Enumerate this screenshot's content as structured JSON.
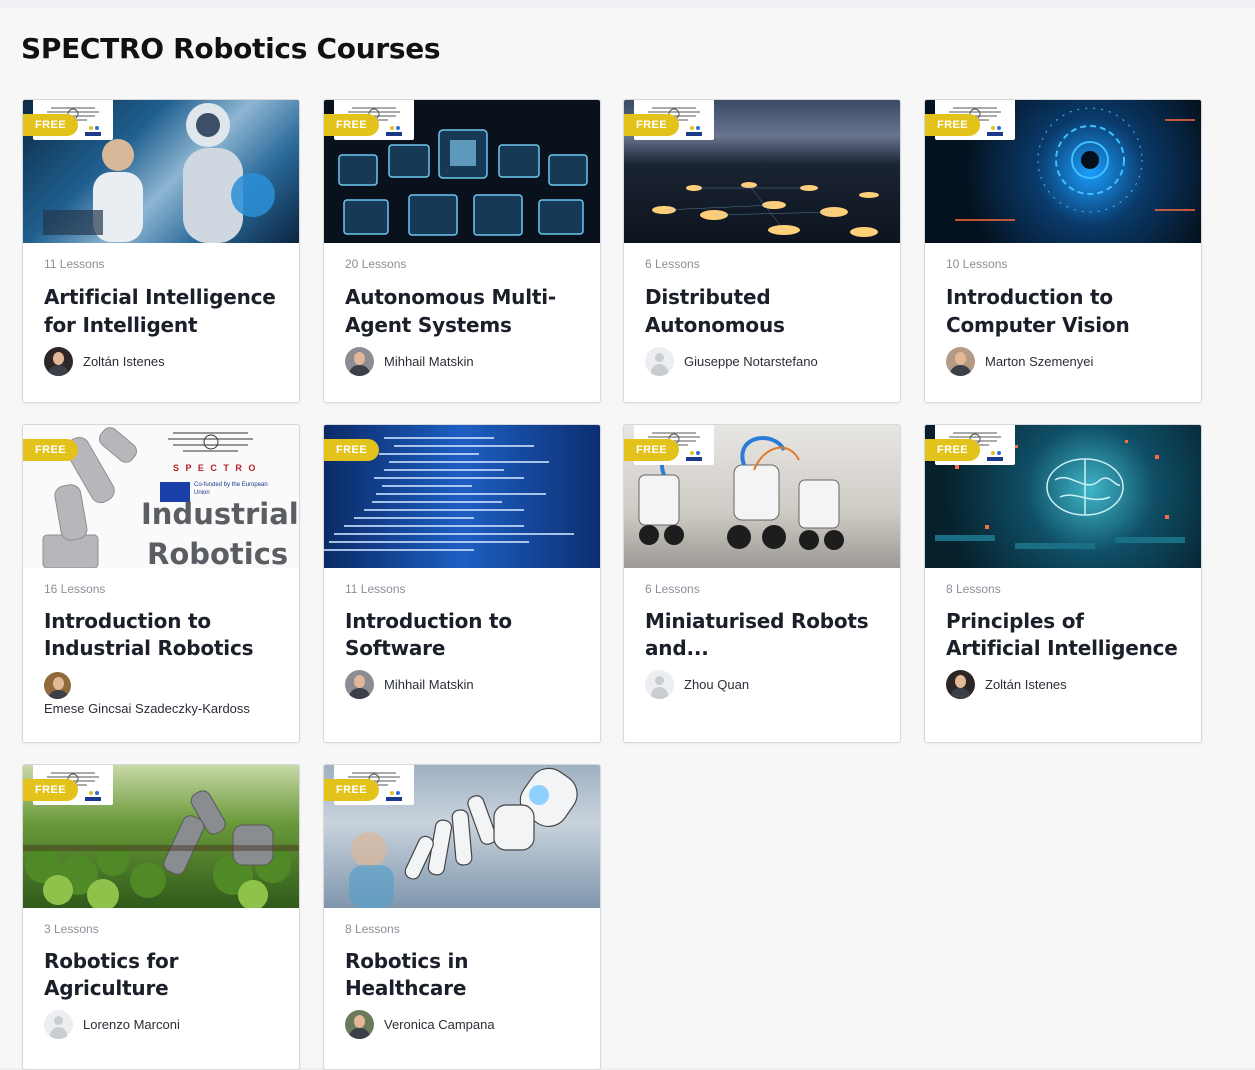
{
  "page": {
    "title": "SPECTRO Robotics Courses"
  },
  "badge": "FREE",
  "courses": [
    {
      "lessons": "11 Lessons",
      "title": "Artificial Intelligence for Intelligent Robots",
      "author": "Zoltán Istenes"
    },
    {
      "lessons": "20 Lessons",
      "title": "Autonomous Multi-Agent Systems",
      "author": "Mihhail Matskin"
    },
    {
      "lessons": "6 Lessons",
      "title": "Distributed Autonomous Systems",
      "author": "Giuseppe Notarstefano"
    },
    {
      "lessons": "10 Lessons",
      "title": "Introduction to Computer Vision",
      "author": "Marton Szemenyei"
    },
    {
      "lessons": "16 Lessons",
      "title": "Introduction to Industrial Robotics",
      "author": "Emese Gincsai Szadeczky-Kardoss",
      "image_text": {
        "brand": "S P E C T R O",
        "cofunded": "Co-funded by the European Union",
        "line1": "Industrial",
        "line2": "Robotics"
      }
    },
    {
      "lessons": "11 Lessons",
      "title": "Introduction to Software Engineerin...",
      "author": "Mihhail Matskin"
    },
    {
      "lessons": "6 Lessons",
      "title": "Miniaturised Robots and...",
      "author": "Zhou Quan"
    },
    {
      "lessons": "8 Lessons",
      "title": "Principles of Artificial Intelligence",
      "author": "Zoltán Istenes"
    },
    {
      "lessons": "3 Lessons",
      "title": "Robotics for Agriculture",
      "author": "Lorenzo Marconi"
    },
    {
      "lessons": "8 Lessons",
      "title": "Robotics in Healthcare",
      "author": "Veronica Campana"
    }
  ]
}
